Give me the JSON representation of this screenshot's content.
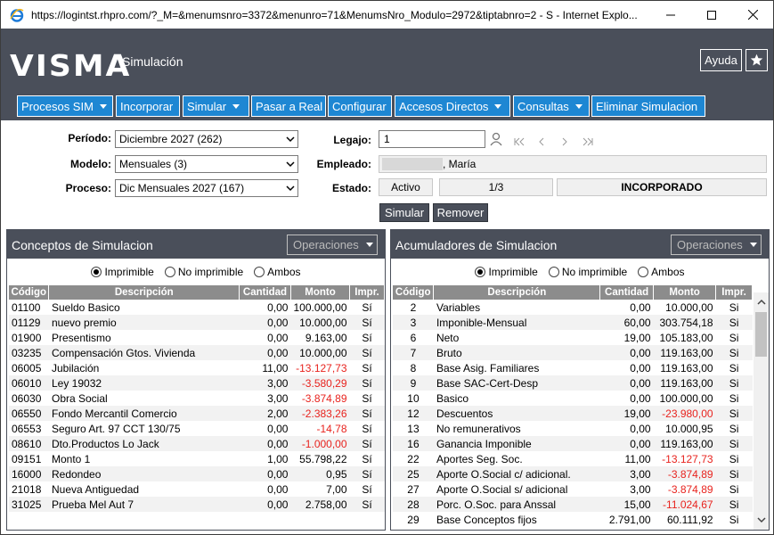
{
  "browser": {
    "title": "https://logintst.rhpro.com/?_M=&menumsnro=3372&menunro=71&MenumsNro_Modulo=2972&tiptabnro=2 - S - Internet Explo..."
  },
  "header": {
    "logo": "VISMA",
    "page_title": "Simulación",
    "help_label": "Ayuda"
  },
  "menu": [
    {
      "label": "Procesos SIM",
      "dropdown": true
    },
    {
      "label": "Incorporar",
      "dropdown": false
    },
    {
      "label": "Simular",
      "dropdown": true
    },
    {
      "label": "Pasar a Real",
      "dropdown": false
    },
    {
      "label": "Configurar",
      "dropdown": false
    },
    {
      "label": "Accesos Directos",
      "dropdown": true
    },
    {
      "label": "Consultas",
      "dropdown": true
    },
    {
      "label": "Eliminar Simulacion",
      "dropdown": false
    }
  ],
  "form": {
    "periodo_label": "Período:",
    "periodo_value": "Diciembre 2027 (262)",
    "modelo_label": "Modelo:",
    "modelo_value": "Mensuales (3)",
    "proceso_label": "Proceso:",
    "proceso_value": "Dic Mensuales 2027 (167)",
    "legajo_label": "Legajo:",
    "legajo_value": "1",
    "empleado_label": "Empleado:",
    "empleado_value": ", María",
    "estado_label": "Estado:",
    "estado_value": "Activo",
    "estado_page": "1/3",
    "estado_status": "INCORPORADO"
  },
  "actions": {
    "simular": "Simular",
    "remover": "Remover"
  },
  "left_panel": {
    "title": "Conceptos de Simulacion",
    "operaciones": "Operaciones",
    "radios": [
      "Imprimible",
      "No imprimible",
      "Ambos"
    ],
    "selected_radio": 0,
    "columns": [
      "Código",
      "Descripción",
      "Cantidad",
      "Monto",
      "Impr."
    ],
    "rows": [
      [
        "01100",
        "Sueldo Basico",
        "0,00",
        "100.000,00",
        "Sí"
      ],
      [
        "01129",
        "nuevo premio",
        "0,00",
        "10.000,00",
        "Sí"
      ],
      [
        "01900",
        "Presentismo",
        "0,00",
        "9.163,00",
        "Sí"
      ],
      [
        "03235",
        "Compensación Gtos. Vivienda",
        "0,00",
        "10.000,00",
        "Sí"
      ],
      [
        "06005",
        "Jubilación",
        "11,00",
        "-13.127,73",
        "Sí"
      ],
      [
        "06010",
        "Ley 19032",
        "3,00",
        "-3.580,29",
        "Sí"
      ],
      [
        "06030",
        "Obra Social",
        "3,00",
        "-3.874,89",
        "Sí"
      ],
      [
        "06550",
        "Fondo Mercantil Comercio",
        "2,00",
        "-2.383,26",
        "Sí"
      ],
      [
        "06553",
        "Seguro Art. 97 CCT 130/75",
        "0,00",
        "-14,78",
        "Sí"
      ],
      [
        "08610",
        "Dto.Productos Lo Jack",
        "0,00",
        "-1.000,00",
        "Sí"
      ],
      [
        "09151",
        "Monto 1",
        "1,00",
        "55.798,22",
        "Sí"
      ],
      [
        "16000",
        "Redondeo",
        "0,00",
        "0,95",
        "Sí"
      ],
      [
        "21018",
        "Nueva Antiguedad",
        "0,00",
        "7,00",
        "Sí"
      ],
      [
        "31025",
        "Prueba Mel Aut 7",
        "0,00",
        "2.758,00",
        "Sí"
      ]
    ]
  },
  "right_panel": {
    "title": "Acumuladores de Simulacion",
    "operaciones": "Operaciones",
    "radios": [
      "Imprimible",
      "No imprimible",
      "Ambos"
    ],
    "selected_radio": 0,
    "columns": [
      "Código",
      "Descripción",
      "Cantidad",
      "Monto",
      "Impr."
    ],
    "rows": [
      [
        "2",
        "Variables",
        "0,00",
        "10.000,00",
        "Si"
      ],
      [
        "3",
        "Imponible-Mensual",
        "60,00",
        "303.754,18",
        "Si"
      ],
      [
        "6",
        "Neto",
        "19,00",
        "105.183,00",
        "Si"
      ],
      [
        "7",
        "Bruto",
        "0,00",
        "119.163,00",
        "Si"
      ],
      [
        "8",
        "Base Asig. Familiares",
        "0,00",
        "119.163,00",
        "Si"
      ],
      [
        "9",
        "Base SAC-Cert-Desp",
        "0,00",
        "119.163,00",
        "Si"
      ],
      [
        "10",
        "Basico",
        "0,00",
        "100.000,00",
        "Si"
      ],
      [
        "12",
        "Descuentos",
        "19,00",
        "-23.980,00",
        "Si"
      ],
      [
        "13",
        "No remunerativos",
        "0,00",
        "10.000,95",
        "Si"
      ],
      [
        "16",
        "Ganancia Imponible",
        "0,00",
        "119.163,00",
        "Si"
      ],
      [
        "22",
        "Aportes Seg. Soc.",
        "11,00",
        "-13.127,73",
        "Si"
      ],
      [
        "25",
        "Aporte O.Social c/ adicional.",
        "3,00",
        "-3.874,89",
        "Si"
      ],
      [
        "27",
        "Aporte O.Social s/ adicional",
        "3,00",
        "-3.874,89",
        "Si"
      ],
      [
        "28",
        "Porc. O.Soc. para Anssal",
        "15,00",
        "-11.024,67",
        "Si"
      ],
      [
        "29",
        "Base Conceptos fijos",
        "2.791,00",
        "60.111,92",
        "Si"
      ]
    ]
  }
}
